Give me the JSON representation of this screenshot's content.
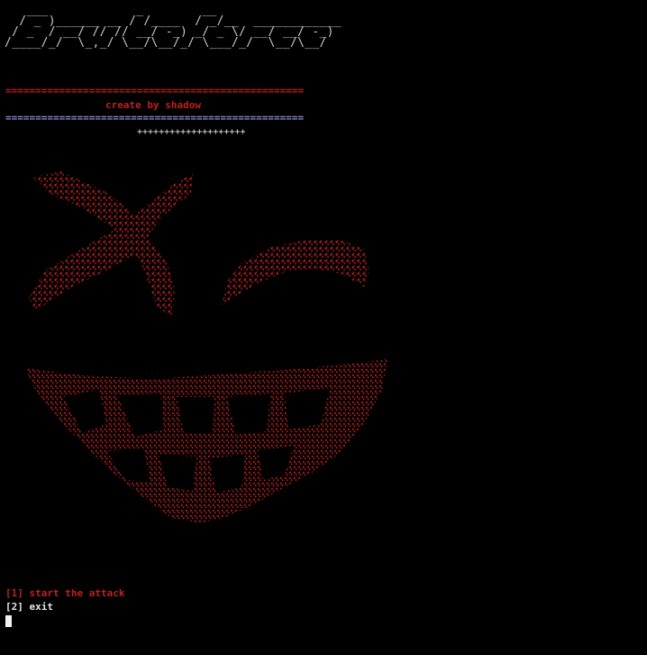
{
  "app": {
    "banner_ascii": "   ___            _        __\n  / _ )______ __ / /____  / _/__  ____________\n / _  / __/ // // __/ -_) _/ _ \\/ __/ __/ -_)\n/____/_/  \\_,_/ \\__/\\__/_/ \\___/_/  \\__/\\__/",
    "credit": "create by shadow",
    "rule_red": "==================================================",
    "rule_blue": "==================================================",
    "separator": "++++++++++++++++++++"
  },
  "menu": {
    "items": [
      {
        "label": "[1] start the attack"
      },
      {
        "label": "[2] exit"
      }
    ]
  },
  "colors": {
    "background": "#000000",
    "accent_red": "#c0201e",
    "rule_blue": "#8e8eda",
    "text": "#e6e6e6"
  },
  "art": {
    "icon": "grinning-face-ascii-art"
  }
}
